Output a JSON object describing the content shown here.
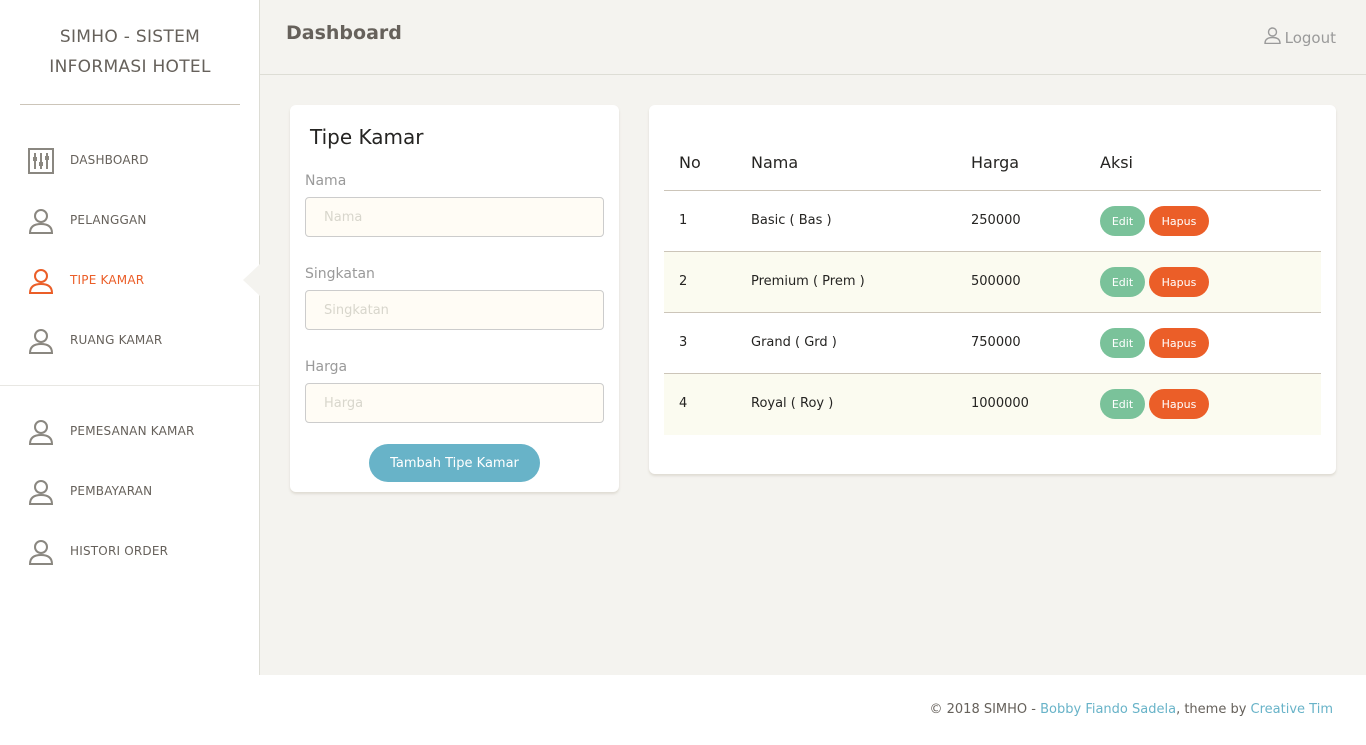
{
  "brand": {
    "line1": "SIMHO - SISTEM",
    "line2": "INFORMASI HOTEL"
  },
  "sidebar": {
    "items": [
      {
        "label": "DASHBOARD",
        "icon": "dashboard-icon"
      },
      {
        "label": "PELANGGAN",
        "icon": "user-icon"
      },
      {
        "label": "TIPE KAMAR",
        "icon": "user-icon",
        "active": true
      },
      {
        "label": "RUANG KAMAR",
        "icon": "user-icon"
      },
      {
        "label": "PEMESANAN KAMAR",
        "icon": "user-icon"
      },
      {
        "label": "PEMBAYARAN",
        "icon": "user-icon"
      },
      {
        "label": "HISTORI ORDER",
        "icon": "user-icon"
      }
    ]
  },
  "header": {
    "title": "Dashboard",
    "logout_label": "Logout"
  },
  "form": {
    "title": "Tipe Kamar",
    "fields": [
      {
        "label": "Nama",
        "placeholder": "Nama",
        "value": ""
      },
      {
        "label": "Singkatan",
        "placeholder": "Singkatan",
        "value": ""
      },
      {
        "label": "Harga",
        "placeholder": "Harga",
        "value": ""
      }
    ],
    "submit_label": "Tambah Tipe Kamar"
  },
  "table": {
    "columns": [
      "No",
      "Nama",
      "Harga",
      "Aksi"
    ],
    "rows": [
      {
        "no": "1",
        "nama": "Basic ( Bas )",
        "harga": "250000"
      },
      {
        "no": "2",
        "nama": "Premium ( Prem )",
        "harga": "500000"
      },
      {
        "no": "3",
        "nama": "Grand ( Grd )",
        "harga": "750000"
      },
      {
        "no": "4",
        "nama": "Royal ( Roy )",
        "harga": "1000000"
      }
    ],
    "edit_label": "Edit",
    "delete_label": "Hapus"
  },
  "footer": {
    "prefix": "© 2018 SIMHO - ",
    "author": "Bobby Fiando Sadela",
    "middle": ", theme by ",
    "theme": "Creative Tim"
  },
  "colors": {
    "accent": "#eb5e28",
    "info": "#68b3c8",
    "success": "#7ac29a",
    "background": "#f4f3ef"
  }
}
